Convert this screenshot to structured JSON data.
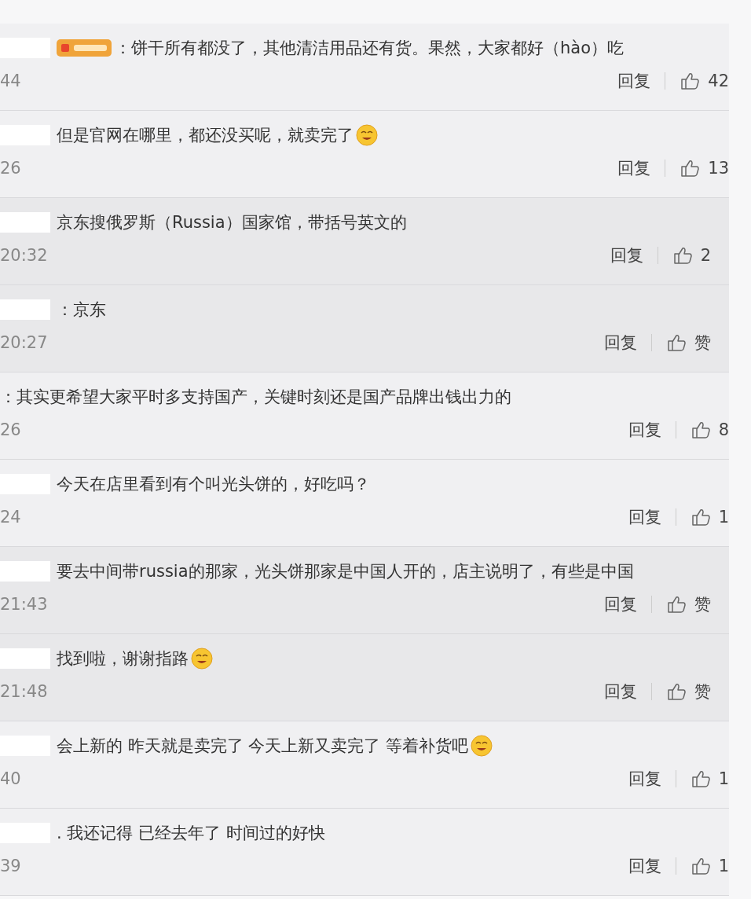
{
  "comments": [
    {
      "kind": "main",
      "redacted": true,
      "badge": true,
      "emoji": false,
      "text": "：饼干所有都没了，其他清洁用品还有货。果然，大家都好（hào）吃",
      "time": "44",
      "reply": "回复",
      "likes": "42"
    },
    {
      "kind": "main",
      "redacted": true,
      "badge": false,
      "emoji": true,
      "text": "但是官网在哪里，都还没买呢，就卖完了",
      "time": "26",
      "reply": "回复",
      "likes": "13"
    },
    {
      "kind": "reply",
      "redacted": true,
      "badge": false,
      "emoji": false,
      "text": "京东搜俄罗斯（Russia）国家馆，带括号英文的",
      "time": "20:32",
      "reply": "回复",
      "likes": "2"
    },
    {
      "kind": "reply",
      "redacted": true,
      "badge": false,
      "emoji": false,
      "text": "：京东",
      "time": "20:27",
      "reply": "回复",
      "likes": "赞"
    },
    {
      "kind": "main",
      "redacted": false,
      "badge": false,
      "emoji": false,
      "text": "：其实更希望大家平时多支持国产，关键时刻还是国产品牌出钱出力的",
      "time": "26",
      "reply": "回复",
      "likes": "8"
    },
    {
      "kind": "main",
      "redacted": true,
      "badge": false,
      "emoji": false,
      "text": "今天在店里看到有个叫光头饼的，好吃吗？",
      "time": "24",
      "reply": "回复",
      "likes": "1"
    },
    {
      "kind": "reply",
      "redacted": true,
      "badge": false,
      "emoji": false,
      "text": "要去中间带russia的那家，光头饼那家是中国人开的，店主说明了，有些是中国",
      "time": "21:43",
      "reply": "回复",
      "likes": "赞"
    },
    {
      "kind": "reply",
      "redacted": true,
      "badge": false,
      "emoji": true,
      "text": "找到啦，谢谢指路",
      "time": "21:48",
      "reply": "回复",
      "likes": "赞"
    },
    {
      "kind": "main",
      "redacted": true,
      "badge": false,
      "emoji": true,
      "text": "会上新的 昨天就是卖完了 今天上新又卖完了 等着补货吧",
      "time": "40",
      "reply": "回复",
      "likes": "1"
    },
    {
      "kind": "main",
      "redacted": true,
      "badge": false,
      "emoji": false,
      "text": ". 我还记得 已经去年了 时间过的好快",
      "time": "39",
      "reply": "回复",
      "likes": "1"
    }
  ]
}
